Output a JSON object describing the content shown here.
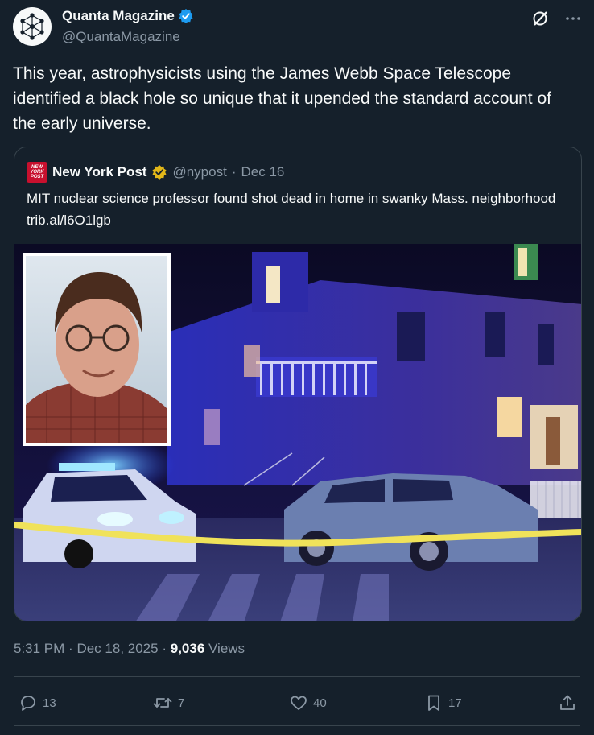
{
  "author": {
    "name": "Quanta Magazine",
    "handle": "@QuantaMagazine",
    "avatar_icon": "network-logo-icon",
    "verified_color": "#1d9bf0"
  },
  "tweet": {
    "text": "This year, astrophysicists using the James Webb Space Telescope identified a black hole so unique that it upended the standard account of the early universe."
  },
  "quoted": {
    "logo_text": "NEW YORK POST",
    "name": "New York Post",
    "verified_color": "#e2b719",
    "handle": "@nypost",
    "separator": "·",
    "date": "Dec 16",
    "text": "MIT nuclear science professor found shot dead in home in swanky Mass. neighborhood trib.al/l6O1lgb",
    "image_icon": "news-photo"
  },
  "meta": {
    "time": "5:31 PM",
    "sep1": "·",
    "date": "Dec 18, 2025",
    "sep2": "·",
    "views_count": "9,036",
    "views_label": "Views"
  },
  "actions": {
    "replies": "13",
    "reposts": "7",
    "likes": "40",
    "bookmarks": "17"
  },
  "colors": {
    "background": "#15202b",
    "text": "#f7f9f9",
    "muted": "#8b98a5",
    "border": "#38444d"
  }
}
